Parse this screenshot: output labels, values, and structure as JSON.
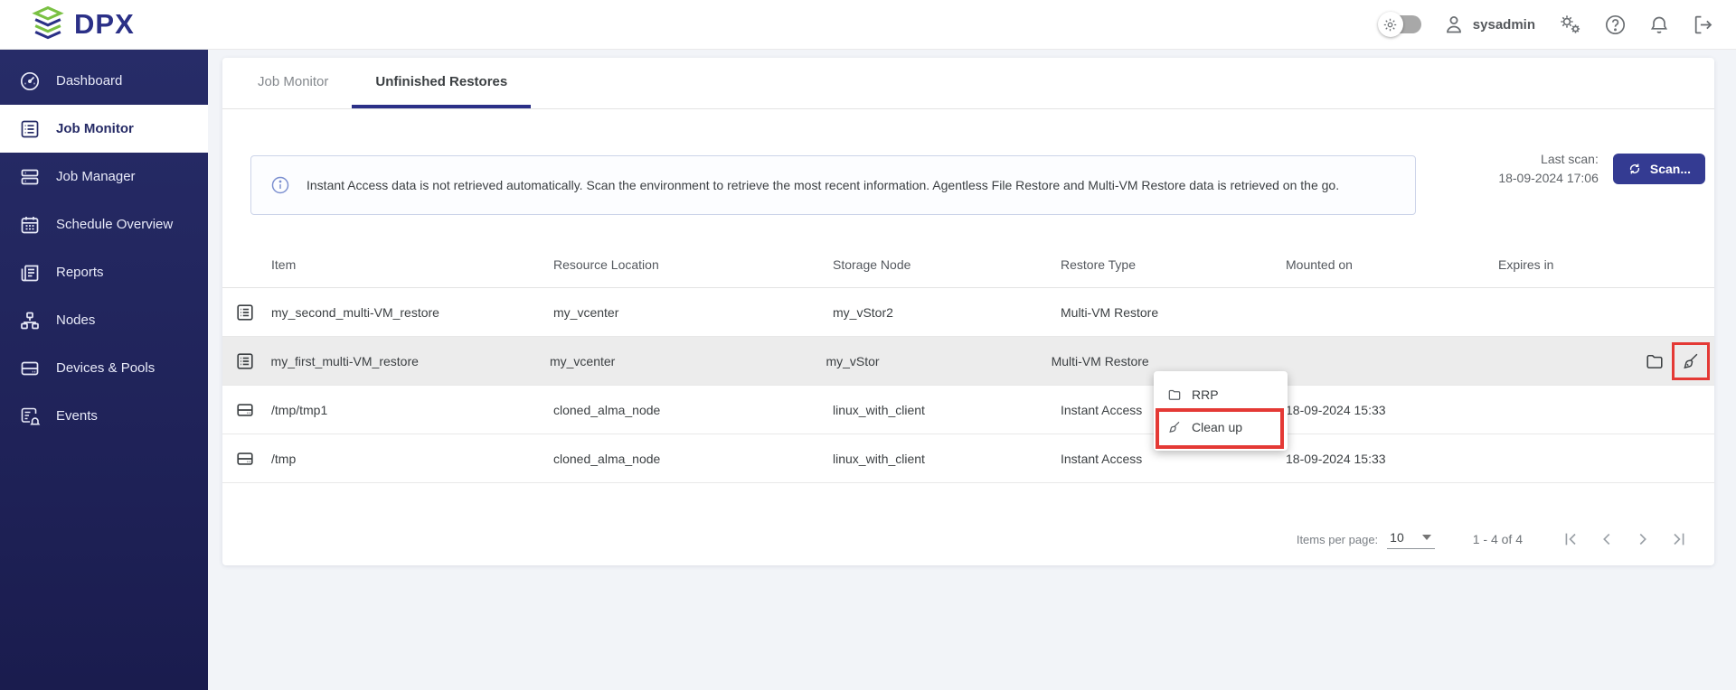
{
  "topbar": {
    "logo_text": "DPX",
    "user": "sysadmin",
    "icons": [
      "settings-toggle",
      "user-icon",
      "gears-icon",
      "help-icon",
      "bell-icon",
      "logout-icon"
    ]
  },
  "sidebar": {
    "items": [
      {
        "label": "Dashboard",
        "icon": "gauge-icon",
        "active": false
      },
      {
        "label": "Job Monitor",
        "icon": "list-box-icon",
        "active": true
      },
      {
        "label": "Job Manager",
        "icon": "stacked-bars-icon",
        "active": false
      },
      {
        "label": "Schedule Overview",
        "icon": "calendar-icon",
        "active": false
      },
      {
        "label": "Reports",
        "icon": "newspaper-icon",
        "active": false
      },
      {
        "label": "Nodes",
        "icon": "org-chart-icon",
        "active": false
      },
      {
        "label": "Devices & Pools",
        "icon": "hard-drive-icon",
        "active": false
      },
      {
        "label": "Events",
        "icon": "event-bell-icon",
        "active": false
      }
    ]
  },
  "tabs": [
    {
      "label": "Job Monitor",
      "active": false
    },
    {
      "label": "Unfinished Restores",
      "active": true
    }
  ],
  "banner": {
    "icon": "info-icon",
    "text": "Instant Access data is not retrieved automatically. Scan the environment to retrieve the most recent information. Agentless File Restore and Multi-VM Restore data is retrieved on the go."
  },
  "scan": {
    "last_scan_label": "Last scan:",
    "last_scan_time": "18-09-2024 17:06",
    "button_label": "Scan...",
    "button_icon": "refresh-icon"
  },
  "table": {
    "columns": [
      "Item",
      "Resource Location",
      "Storage Node",
      "Restore Type",
      "Mounted on",
      "Expires in"
    ],
    "rows": [
      {
        "icon": "list-box-icon",
        "item": "my_second_multi-VM_restore",
        "resource_location": "my_vcenter",
        "storage_node": "my_vStor2",
        "restore_type": "Multi-VM Restore",
        "mounted_on": "",
        "expires_in": "",
        "highlighted": false
      },
      {
        "icon": "list-box-icon",
        "item": "my_first_multi-VM_restore",
        "resource_location": "my_vcenter",
        "storage_node": "my_vStor",
        "restore_type": "Multi-VM Restore",
        "mounted_on": "",
        "expires_in": "",
        "highlighted": true,
        "row_actions": [
          "folder-icon",
          "broom-icon"
        ],
        "annotation": "red-box-on-broom"
      },
      {
        "icon": "hard-drive-icon",
        "item": "/tmp/tmp1",
        "resource_location": "cloned_alma_node",
        "storage_node": "linux_with_client",
        "restore_type": "Instant Access",
        "mounted_on": "18-09-2024 15:33",
        "expires_in": "",
        "highlighted": false
      },
      {
        "icon": "hard-drive-icon",
        "item": "/tmp",
        "resource_location": "cloned_alma_node",
        "storage_node": "linux_with_client",
        "restore_type": "Instant Access",
        "mounted_on": "18-09-2024 15:33",
        "expires_in": "",
        "highlighted": false
      }
    ]
  },
  "context_menu": {
    "items": [
      {
        "label": "RRP",
        "icon": "folder-icon",
        "annotated": false
      },
      {
        "label": "Clean up",
        "icon": "broom-icon",
        "annotated": true
      }
    ]
  },
  "pagination": {
    "items_per_page_label": "Items per page:",
    "items_per_page": "10",
    "range": "1 - 4 of 4",
    "nav_icons": [
      "first-page-icon",
      "prev-page-icon",
      "next-page-icon",
      "last-page-icon"
    ]
  },
  "colors": {
    "accent_navy": "#2b3087",
    "button_navy": "#343b92",
    "sidebar_navy_top": "#272c68",
    "sidebar_navy_bottom": "#1a1c4e",
    "logo_green": "#7ac143",
    "annotation_red": "#e43935",
    "row_highlight": "#ececec",
    "page_bg": "#f2f4f8"
  }
}
